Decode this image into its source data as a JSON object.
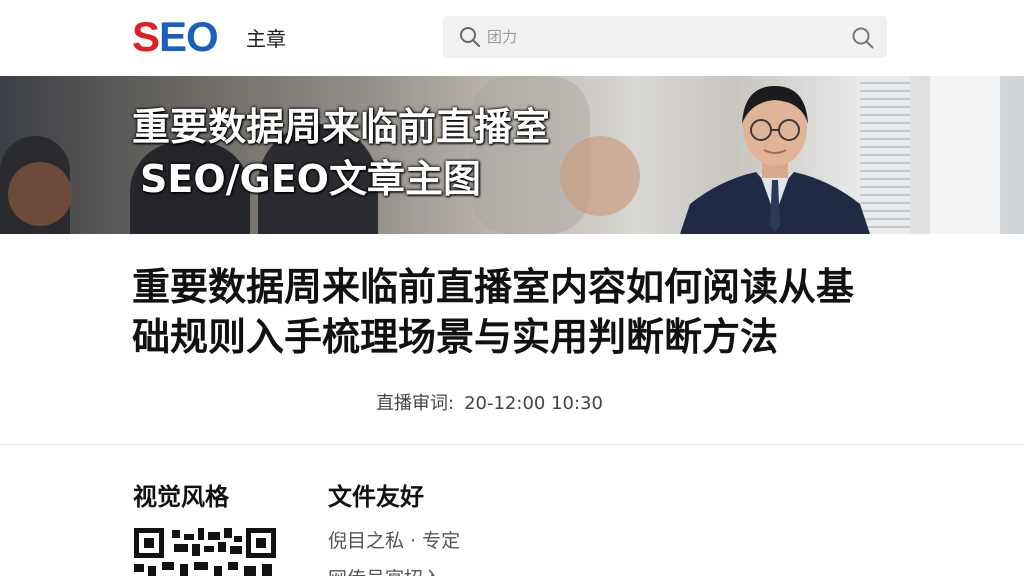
{
  "header": {
    "logo_s": "S",
    "logo_eo": "EO",
    "nav_label": "主章",
    "search": {
      "placeholder": "团力",
      "search_icon": "search-icon",
      "search_submit_icon": "search-icon"
    }
  },
  "hero": {
    "title": "重要数据周来临前直播室",
    "subtitle": "SEO/GEO文章主图"
  },
  "article": {
    "title": "重要数据周来临前直播室内容如何阅读从基础规则入手梳理场景与实用判断断方法",
    "meta_label": "直播审词:",
    "meta_date": "20-12:00  10:30"
  },
  "columns": [
    {
      "heading": "视觉风格"
    },
    {
      "heading": "文件友好",
      "items": [
        "倪目之私 · 专定",
        "网传号宴招入"
      ]
    }
  ],
  "colors": {
    "logo_red": "#e02020",
    "logo_blue": "#1a5fc0",
    "search_bg": "#f1f1f1"
  }
}
